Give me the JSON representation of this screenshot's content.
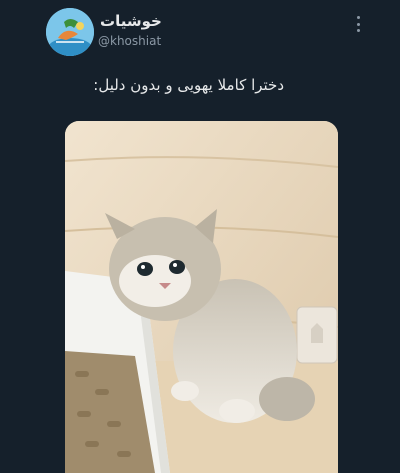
{
  "tweet": {
    "author_name": "خوشیات",
    "author_handle": "@khoshiat",
    "text": "دخترا کاملا یهویی و بدون دلیل:",
    "avatar_icon": "profile-avatar-icon",
    "more_icon": "more-options-icon"
  },
  "media": {
    "subject_icon": "kitten-photo"
  },
  "colors": {
    "background": "#15202b",
    "text_primary": "#e7e9ea",
    "text_secondary": "#8b98a5"
  }
}
